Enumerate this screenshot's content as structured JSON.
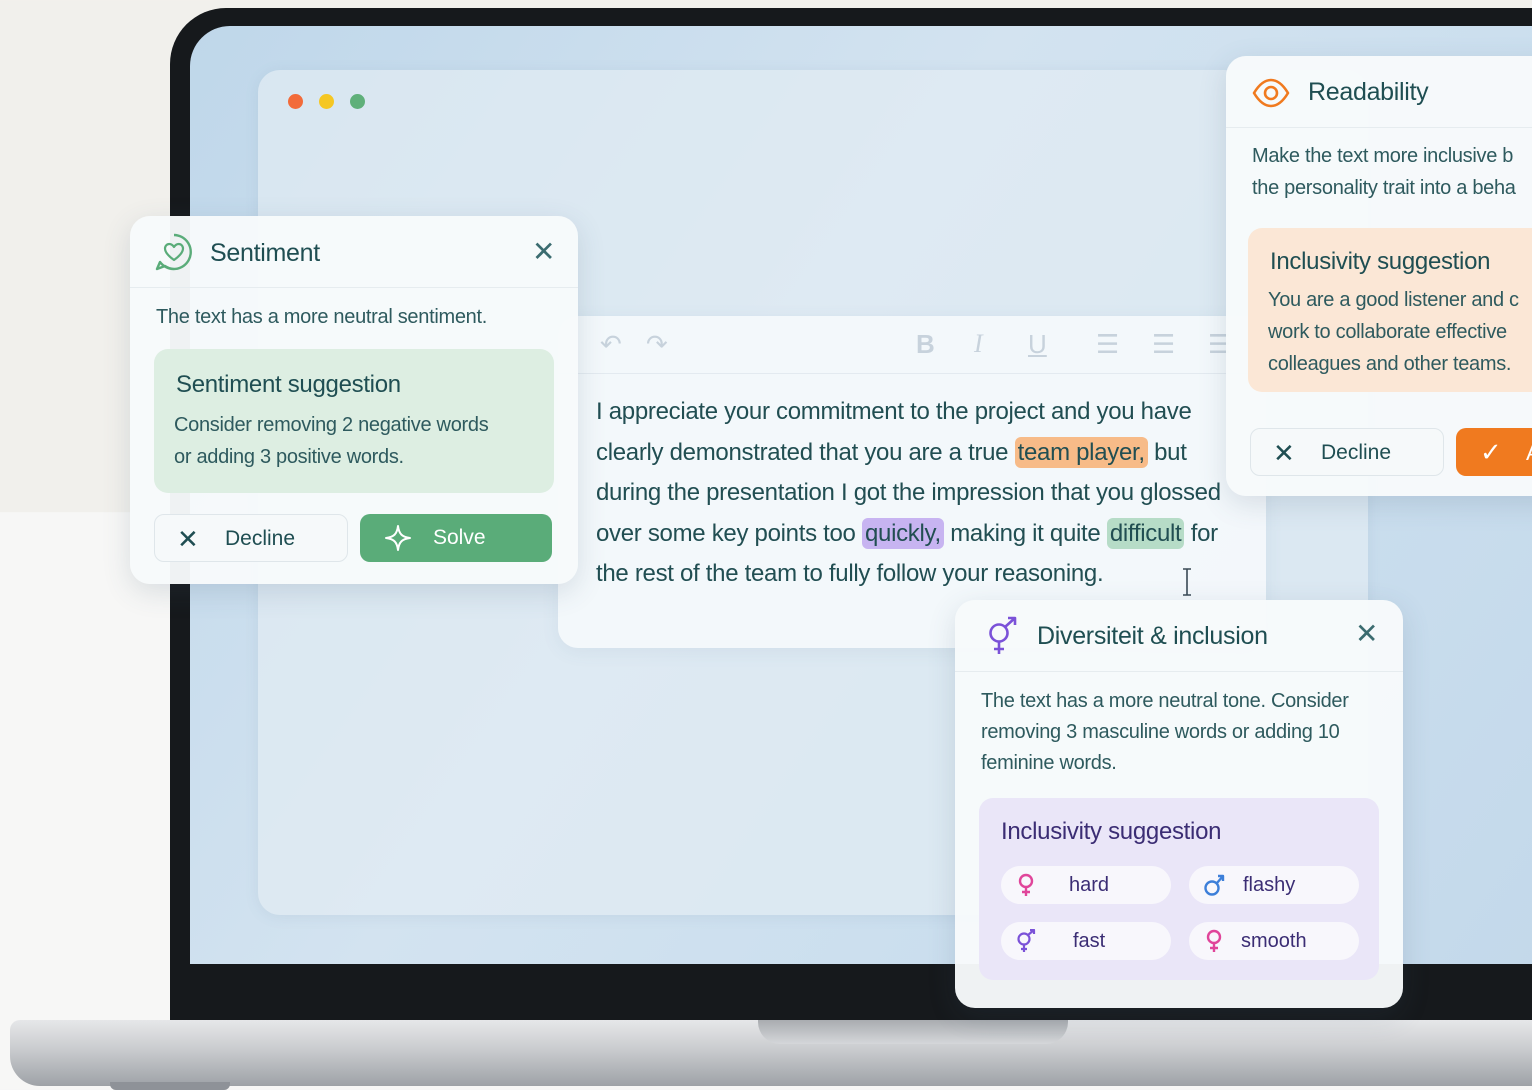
{
  "app": {
    "window_controls": [
      "close",
      "minimize",
      "maximize"
    ]
  },
  "editor": {
    "toolbar": {
      "undo": "↶",
      "redo": "↷",
      "bold": "B",
      "italic": "I",
      "underline": "U",
      "align_left": "☰",
      "align_center": "☰",
      "align_right": "☰"
    },
    "text": {
      "part1": "I appreciate your commitment to the project and you have clearly demonstrated that you are a true ",
      "highlight_team_player": "team player,",
      "part2": " but during the presentation I got the impression that you glossed over some key points too ",
      "highlight_quickly": "quickly,",
      "part3": " making it quite ",
      "highlight_difficult": "difficult",
      "part4": " for the rest of the team to fully follow your reasoning."
    }
  },
  "sentiment": {
    "title": "Sentiment",
    "close": "✕",
    "description": "The text has a more neutral sentiment.",
    "suggestion_title": "Sentiment suggestion",
    "suggestion_body_line1": "Consider removing 2 negative words",
    "suggestion_body_line2": "or adding 3 positive words.",
    "decline_label": "Decline",
    "solve_label": "Solve"
  },
  "readability": {
    "title": "Readability",
    "description_line1": "Make the text more inclusive b",
    "description_line2": "the personality trait into a beha",
    "suggestion_title": "Inclusivity suggestion",
    "suggestion_line1": "You are a good listener and c",
    "suggestion_line2": "work to collaborate effective",
    "suggestion_line3": "colleagues and other teams.",
    "decline_label": "Decline",
    "accept_label": "A"
  },
  "diversity": {
    "title": "Diversiteit & inclusion",
    "close": "✕",
    "description": "The text has a more neutral tone. Consider removing 3 masculine words or adding 10 feminine words.",
    "suggestion_title": "Inclusivity suggestion",
    "chips": [
      {
        "label": "hard",
        "icon": "female-icon"
      },
      {
        "label": "flashy",
        "icon": "male-icon"
      },
      {
        "label": "fast",
        "icon": "gender-neutral-icon"
      },
      {
        "label": "smooth",
        "icon": "female-icon"
      }
    ]
  },
  "colors": {
    "sentiment_accent": "#5aac79",
    "readability_accent": "#f07a1f",
    "diversity_accent": "#7b52d8",
    "highlight_orange": "#f7bb88",
    "highlight_purple": "#c7b4f1",
    "highlight_green": "#b6dcc7"
  }
}
